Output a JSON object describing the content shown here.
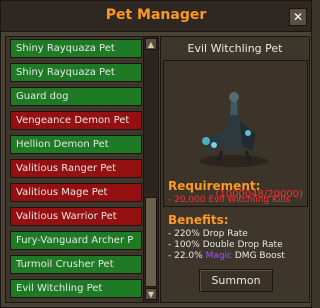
{
  "window": {
    "title": "Pet Manager",
    "close_label": "✕"
  },
  "pets": [
    {
      "name": "Shiny Rayquaza Pet",
      "status": "green"
    },
    {
      "name": "Shiny Rayquaza Pet",
      "status": "green"
    },
    {
      "name": "Guard dog",
      "status": "green"
    },
    {
      "name": "Vengeance Demon Pet",
      "status": "red"
    },
    {
      "name": "Hellion Demon Pet",
      "status": "green"
    },
    {
      "name": "Valitious Ranger Pet",
      "status": "red"
    },
    {
      "name": "Valitious Mage Pet",
      "status": "red"
    },
    {
      "name": "Valitious Warrior Pet",
      "status": "red"
    },
    {
      "name": "Fury-Vanguard Archer P",
      "status": "green"
    },
    {
      "name": "Turmoil Crusher Pet",
      "status": "green"
    },
    {
      "name": "Evil Witchling Pet",
      "status": "green"
    }
  ],
  "selected": {
    "name": "Evil Witchling Pet",
    "kill_progress": "(1000048/20000)",
    "requirement_heading": "Requirement:",
    "requirement": "- 20,000 Evil Witchling Kills",
    "benefits_heading": "Benefits:",
    "benefit_1": "- 220% Drop Rate",
    "benefit_2": "- 100% Double Drop Rate",
    "benefit_3_prefix": "- 22.0% ",
    "benefit_3_magic": "Magic",
    "benefit_3_suffix": " DMG Boost",
    "summon_label": "Summon"
  },
  "colors": {
    "accent": "#ff981f",
    "unlocked": "#1e7a25",
    "locked": "#951010",
    "requirement_text": "#ff3030",
    "magic": "#a050ff"
  },
  "icons": {
    "scroll_up": "triangle-up-icon",
    "scroll_down": "triangle-down-icon",
    "close": "close-icon"
  }
}
